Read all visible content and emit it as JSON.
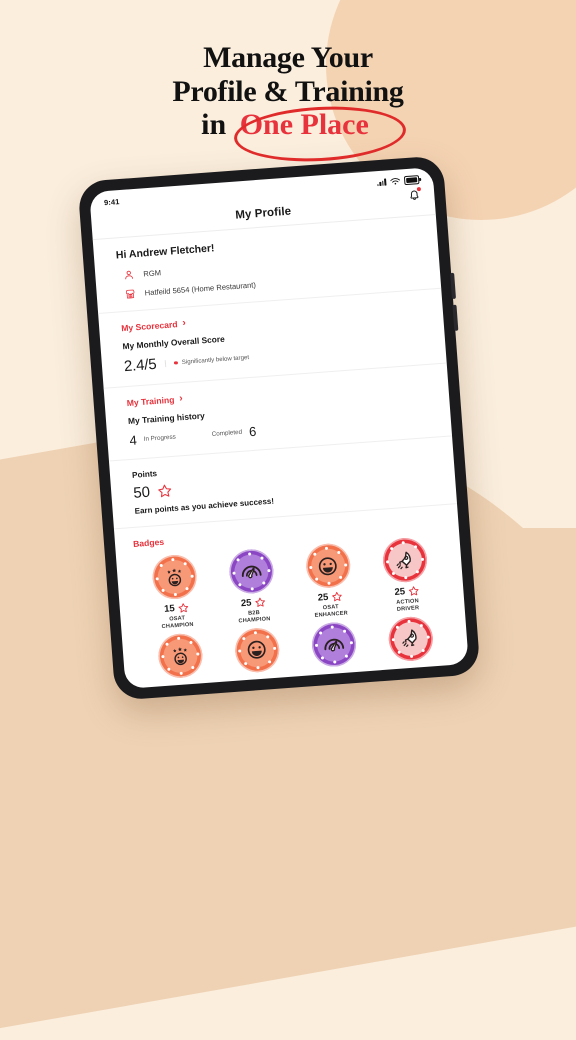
{
  "headline": {
    "line1": "Manage Your",
    "line2": "Profile & Training",
    "line3_prefix": "in ",
    "line3_highlight": "One Place",
    "highlight_color": "#E8323C"
  },
  "device": {
    "status_bar": {
      "time": "9:41",
      "signal_icon": "signal-bars-icon",
      "wifi_icon": "wifi-icon",
      "battery_icon": "battery-full-icon"
    },
    "nav": {
      "title": "My Profile",
      "bell_icon": "bell-notification-icon",
      "has_unread_dot": true
    }
  },
  "profile": {
    "greeting": "Hi Andrew Fletcher!",
    "rows": [
      {
        "icon": "person-icon",
        "label": "RGM"
      },
      {
        "icon": "store-icon",
        "label": "Hatfeild 5654 (Home Restaurant)"
      }
    ]
  },
  "scorecard": {
    "link_label": "My Scorecard",
    "chevron": "›",
    "subhead": "My Monthly Overall Score",
    "score": "2.4/5",
    "status_text": "Significantly below target",
    "status_color": "#E8323C"
  },
  "training": {
    "link_label": "My Training",
    "chevron": "›",
    "subhead": "My Training history",
    "in_progress_count": "4",
    "in_progress_label": "In Progress",
    "completed_label": "Completed",
    "completed_count": "6"
  },
  "points": {
    "label": "Points",
    "value": "50",
    "star_icon": "star-outline-icon",
    "caption": "Earn points as you achieve success!"
  },
  "badges": {
    "title": "Badges",
    "items": [
      {
        "points": "15",
        "name": "OSAT\nCHAMPION",
        "name_l1": "OSAT",
        "name_l2": "CHAMPION",
        "color": "#F2704A",
        "inner": "#F79877",
        "icon": "smiley-stars-icon"
      },
      {
        "points": "25",
        "name": "B2B CHAMPION",
        "name_l1": "B2B",
        "name_l2": "CHAMPION",
        "color": "#8B46C4",
        "inner": "#B07FDC",
        "icon": "gauge-icon"
      },
      {
        "points": "25",
        "name": "OSAT ENHANCER",
        "name_l1": "OSAT",
        "name_l2": "ENHANCER",
        "color": "#F2704A",
        "inner": "#F79877",
        "icon": "smiley-icon"
      },
      {
        "points": "25",
        "name": "ACTION DRIVER",
        "name_l1": "ACTION",
        "name_l2": "DRIVER",
        "color": "#E8323C",
        "inner": "#F7C6C6",
        "icon": "rocket-icon"
      }
    ],
    "row2_items": [
      {
        "color": "#F2704A",
        "inner": "#F79877",
        "icon": "smiley-stars-icon"
      },
      {
        "color": "#F2704A",
        "inner": "#F79877",
        "icon": "smiley-icon"
      },
      {
        "color": "#8B46C4",
        "inner": "#B07FDC",
        "icon": "gauge-icon"
      },
      {
        "color": "#E8323C",
        "inner": "#F7C6C6",
        "icon": "rocket-icon"
      }
    ]
  },
  "theme": {
    "background": "#FBEEDD",
    "accent_red": "#E8323C",
    "tan": "#EFD2B4"
  }
}
